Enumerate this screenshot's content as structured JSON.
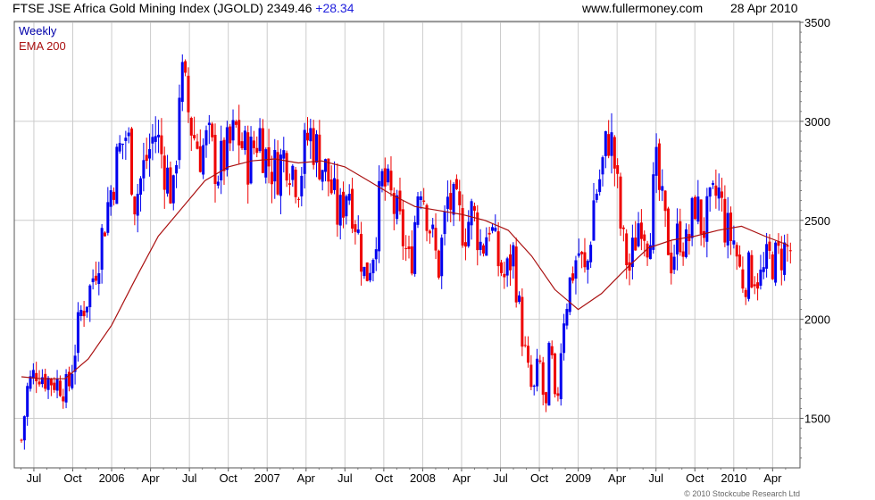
{
  "header": {
    "title": "FTSE JSE Africa Gold Mining Index (JGOLD)",
    "last": "2349.46",
    "change": "+28.34",
    "site": "www.fullermoney.com",
    "date": "28 Apr 2010"
  },
  "legend": {
    "weekly": "Weekly",
    "ema": "EMA 200"
  },
  "copyright": "© 2010 Stockcube Research Ltd",
  "colors": {
    "up": "#0000ee",
    "down": "#ee0000",
    "ema": "#aa1111",
    "grid": "#cccccc",
    "title_change": "#2020dd",
    "legend_weekly": "#0000aa",
    "legend_ema": "#aa1111"
  },
  "chart_data": {
    "type": "line",
    "title": "FTSE JSE Africa Gold Mining Index (JGOLD)",
    "ylim": [
      1250,
      3500
    ],
    "xlim": [
      2005.42,
      2010.38
    ],
    "scale": "linear",
    "grid": true,
    "y_ticks": [
      1500,
      2000,
      2500,
      3000,
      3500
    ],
    "x_ticks": [
      {
        "label": "Jul",
        "t": 2005.5
      },
      {
        "label": "Oct",
        "t": 2005.75
      },
      {
        "label": "2006",
        "t": 2006.0
      },
      {
        "label": "Apr",
        "t": 2006.25
      },
      {
        "label": "Jul",
        "t": 2006.5
      },
      {
        "label": "Oct",
        "t": 2006.75
      },
      {
        "label": "2007",
        "t": 2007.0
      },
      {
        "label": "Apr",
        "t": 2007.25
      },
      {
        "label": "Jul",
        "t": 2007.5
      },
      {
        "label": "Oct",
        "t": 2007.75
      },
      {
        "label": "2008",
        "t": 2008.0
      },
      {
        "label": "Apr",
        "t": 2008.25
      },
      {
        "label": "Jul",
        "t": 2008.5
      },
      {
        "label": "Oct",
        "t": 2008.75
      },
      {
        "label": "2009",
        "t": 2009.0
      },
      {
        "label": "Apr",
        "t": 2009.25
      },
      {
        "label": "Jul",
        "t": 2009.5
      },
      {
        "label": "Oct",
        "t": 2009.75
      },
      {
        "label": "2010",
        "t": 2010.0
      },
      {
        "label": "Apr",
        "t": 2010.25
      }
    ],
    "series": [
      {
        "name": "Weekly",
        "kind": "ohlc-bars",
        "anchors": [
          [
            2005.42,
            1390
          ],
          [
            2005.46,
            1660
          ],
          [
            2005.52,
            1750
          ],
          [
            2005.58,
            1700
          ],
          [
            2005.66,
            1680
          ],
          [
            2005.72,
            1640
          ],
          [
            2005.8,
            2030
          ],
          [
            2005.86,
            2150
          ],
          [
            2005.92,
            2350
          ],
          [
            2005.98,
            2600
          ],
          [
            2006.05,
            2850
          ],
          [
            2006.1,
            2950
          ],
          [
            2006.15,
            2600
          ],
          [
            2006.22,
            2800
          ],
          [
            2006.28,
            2950
          ],
          [
            2006.35,
            2750
          ],
          [
            2006.4,
            2600
          ],
          [
            2006.44,
            3250
          ],
          [
            2006.48,
            3100
          ],
          [
            2006.52,
            2950
          ],
          [
            2006.57,
            2850
          ],
          [
            2006.62,
            2900
          ],
          [
            2006.68,
            2750
          ],
          [
            2006.75,
            2850
          ],
          [
            2006.8,
            2950
          ],
          [
            2006.88,
            2800
          ],
          [
            2006.95,
            2950
          ],
          [
            2007.0,
            2800
          ],
          [
            2007.06,
            2750
          ],
          [
            2007.12,
            2850
          ],
          [
            2007.2,
            2700
          ],
          [
            2007.27,
            2950
          ],
          [
            2007.32,
            2850
          ],
          [
            2007.4,
            2700
          ],
          [
            2007.46,
            2500
          ],
          [
            2007.52,
            2700
          ],
          [
            2007.58,
            2450
          ],
          [
            2007.63,
            2200
          ],
          [
            2007.68,
            2350
          ],
          [
            2007.74,
            2700
          ],
          [
            2007.8,
            2600
          ],
          [
            2007.86,
            2450
          ],
          [
            2007.92,
            2250
          ],
          [
            2007.98,
            2750
          ],
          [
            2008.04,
            2500
          ],
          [
            2008.1,
            2250
          ],
          [
            2008.16,
            2600
          ],
          [
            2008.21,
            2550
          ],
          [
            2008.27,
            2450
          ],
          [
            2008.32,
            2550
          ],
          [
            2008.38,
            2350
          ],
          [
            2008.43,
            2500
          ],
          [
            2008.48,
            2300
          ],
          [
            2008.53,
            2200
          ],
          [
            2008.58,
            2350
          ],
          [
            2008.62,
            2050
          ],
          [
            2008.67,
            1750
          ],
          [
            2008.71,
            1600
          ],
          [
            2008.75,
            1800
          ],
          [
            2008.79,
            1500
          ],
          [
            2008.82,
            1900
          ],
          [
            2008.85,
            1550
          ],
          [
            2008.87,
            1650
          ],
          [
            2008.9,
            2000
          ],
          [
            2008.95,
            2200
          ],
          [
            2009.0,
            2350
          ],
          [
            2009.05,
            2200
          ],
          [
            2009.1,
            2600
          ],
          [
            2009.15,
            2750
          ],
          [
            2009.2,
            2950
          ],
          [
            2009.24,
            2750
          ],
          [
            2009.28,
            2400
          ],
          [
            2009.33,
            2250
          ],
          [
            2009.4,
            2550
          ],
          [
            2009.45,
            2400
          ],
          [
            2009.5,
            2750
          ],
          [
            2009.55,
            2500
          ],
          [
            2009.6,
            2300
          ],
          [
            2009.65,
            2450
          ],
          [
            2009.7,
            2350
          ],
          [
            2009.75,
            2600
          ],
          [
            2009.8,
            2450
          ],
          [
            2009.85,
            2550
          ],
          [
            2009.9,
            2650
          ],
          [
            2009.95,
            2450
          ],
          [
            2010.0,
            2400
          ],
          [
            2010.05,
            2200
          ],
          [
            2010.12,
            2250
          ],
          [
            2010.18,
            2200
          ],
          [
            2010.22,
            2300
          ],
          [
            2010.28,
            2300
          ],
          [
            2010.32,
            2349.46
          ]
        ]
      },
      {
        "name": "EMA 200",
        "kind": "line",
        "points": [
          [
            2005.42,
            1710
          ],
          [
            2005.55,
            1700
          ],
          [
            2005.7,
            1700
          ],
          [
            2005.85,
            1800
          ],
          [
            2006.0,
            1970
          ],
          [
            2006.15,
            2200
          ],
          [
            2006.3,
            2420
          ],
          [
            2006.45,
            2560
          ],
          [
            2006.6,
            2700
          ],
          [
            2006.75,
            2770
          ],
          [
            2006.9,
            2800
          ],
          [
            2007.05,
            2810
          ],
          [
            2007.2,
            2790
          ],
          [
            2007.35,
            2800
          ],
          [
            2007.5,
            2770
          ],
          [
            2007.65,
            2700
          ],
          [
            2007.8,
            2630
          ],
          [
            2007.95,
            2570
          ],
          [
            2008.1,
            2550
          ],
          [
            2008.25,
            2530
          ],
          [
            2008.4,
            2500
          ],
          [
            2008.55,
            2450
          ],
          [
            2008.7,
            2320
          ],
          [
            2008.85,
            2150
          ],
          [
            2009.0,
            2050
          ],
          [
            2009.15,
            2130
          ],
          [
            2009.3,
            2250
          ],
          [
            2009.45,
            2360
          ],
          [
            2009.6,
            2400
          ],
          [
            2009.75,
            2420
          ],
          [
            2009.9,
            2450
          ],
          [
            2010.05,
            2470
          ],
          [
            2010.2,
            2420
          ],
          [
            2010.35,
            2375
          ]
        ]
      }
    ]
  }
}
